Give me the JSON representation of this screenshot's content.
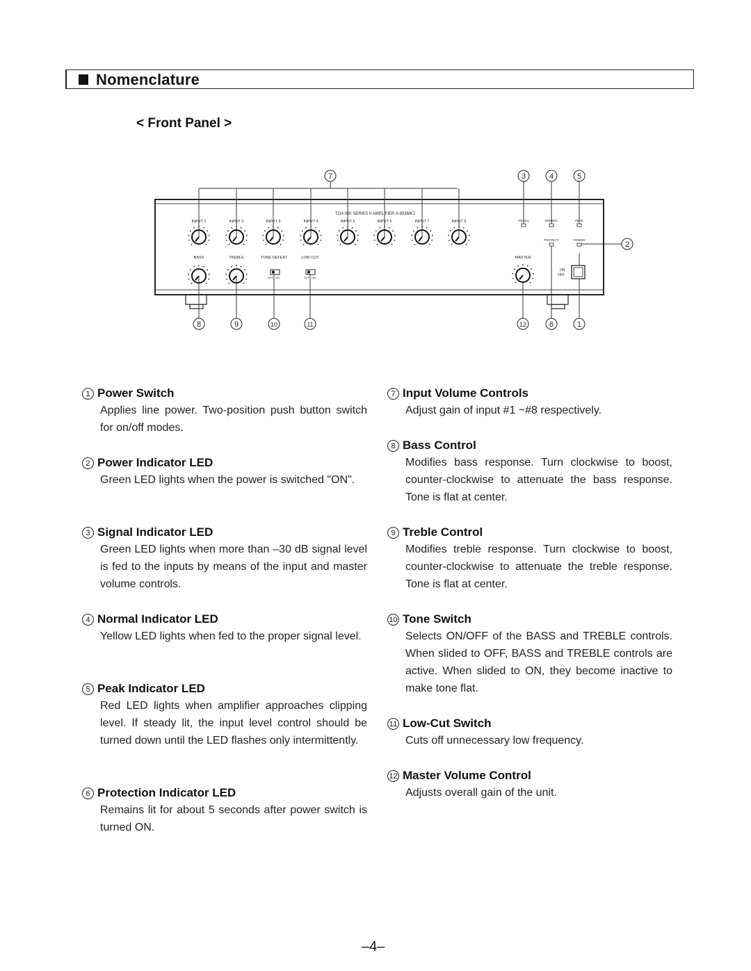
{
  "header": {
    "title": "Nomenclature",
    "subtitle": "< Front Panel >"
  },
  "panel": {
    "brand_label": "TOA 900 SERIES II AMPLIFIER A-903MK2",
    "input_labels": [
      "INPUT 1",
      "INPUT 2",
      "INPUT 3",
      "INPUT 4",
      "INPUT 5",
      "INPUT 6",
      "INPUT 7",
      "INPUT 8"
    ],
    "tone_labels": [
      "BASS",
      "TREBLE"
    ],
    "switch_labels": [
      "TONE DEFEAT",
      "LOW CUT"
    ],
    "switch_positions": [
      "OFF",
      "ON"
    ],
    "led_labels": [
      "SIGNAL",
      "NORMAL",
      "PEAK",
      "PROTECT",
      "POWER"
    ],
    "master_label": "MASTER",
    "power_switch_labels": [
      "ON",
      "OFF"
    ],
    "callouts": {
      "c1": "1",
      "c2": "2",
      "c3": "3",
      "c4": "4",
      "c5": "5",
      "c6": "6",
      "c7": "7",
      "c8": "8",
      "c9": "9",
      "c10": "10",
      "c11": "11",
      "c12": "12"
    }
  },
  "items_left": [
    {
      "num": "1",
      "title": "Power Switch",
      "desc": "Applies line power. Two-position push button switch for on/off modes."
    },
    {
      "num": "2",
      "title": "Power Indicator LED",
      "desc": "Green LED lights when the power is switched \"ON\"."
    },
    {
      "num": "3",
      "title": "Signal Indicator LED",
      "desc": "Green LED lights when more than –30 dB signal level is fed to the inputs by means of the input and master volume controls."
    },
    {
      "num": "4",
      "title": "Normal Indicator LED",
      "desc": "Yellow LED lights when fed to the proper signal level."
    },
    {
      "num": "5",
      "title": "Peak Indicator LED",
      "desc": "Red LED lights when amplifier approaches clipping level. If steady lit, the input level control should be turned down until the LED flashes only intermittently."
    },
    {
      "num": "6",
      "title": "Protection Indicator LED",
      "desc": "Remains lit for about 5 seconds after power switch is turned ON."
    }
  ],
  "items_right": [
    {
      "num": "7",
      "title": "Input Volume Controls",
      "desc": "Adjust gain of input #1 ~#8 respectively."
    },
    {
      "num": "8",
      "title": "Bass Control",
      "desc": "Modifies bass response. Turn clockwise to boost, counter-clockwise to attenuate the bass response. Tone is flat at center."
    },
    {
      "num": "9",
      "title": "Treble Control",
      "desc": "Modifies treble response. Turn clockwise to boost, counter-clockwise to attenuate the treble response. Tone is flat at center."
    },
    {
      "num": "10",
      "title": "Tone Switch",
      "desc": "Selects ON/OFF of the BASS and TREBLE controls. When slided to OFF, BASS and TREBLE controls are active. When slided to ON, they become inactive to make tone flat."
    },
    {
      "num": "11",
      "title": "Low-Cut Switch",
      "desc": "Cuts off unnecessary low frequency."
    },
    {
      "num": "12",
      "title": "Master Volume Control",
      "desc": "Adjusts overall gain of the unit."
    }
  ],
  "footer": {
    "page_number": "–4–"
  }
}
